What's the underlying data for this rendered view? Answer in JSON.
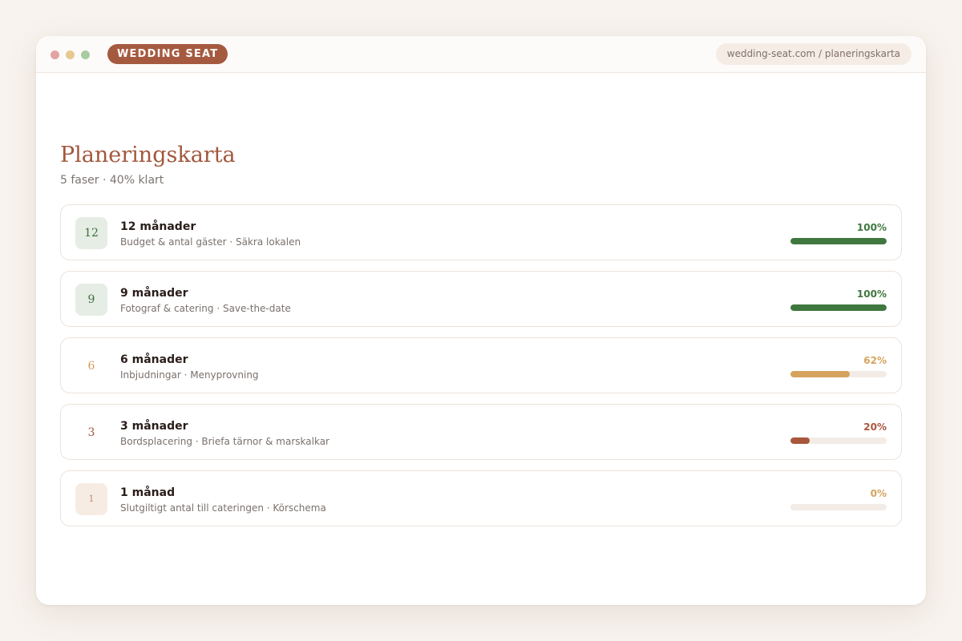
{
  "window": {
    "traffic_lights": [
      "close",
      "minimize",
      "maximize"
    ]
  },
  "brand": "WEDDING SEAT",
  "url": "wedding-seat.com / planeringskarta",
  "page": {
    "title": "Planeringskarta",
    "subtitle": "5 faser · 40% klart"
  },
  "colors": {
    "done": "#3f773e",
    "mid": "#d5a35d",
    "low": "#a8573c",
    "track": "#f3ece6",
    "accent": "#a2573c"
  },
  "phases": [
    {
      "badge": "12",
      "title": "12 månader",
      "tasks": "Budget & antal gäster · Säkra lokalen",
      "percent_label": "100%",
      "progress": 100,
      "status": "done"
    },
    {
      "badge": "9",
      "title": "9 månader",
      "tasks": "Fotograf & catering · Save-the-date",
      "percent_label": "100%",
      "progress": 100,
      "status": "done"
    },
    {
      "badge": "6",
      "title": "6 månader",
      "tasks": "Inbjudningar · Menyprovning",
      "percent_label": "62%",
      "progress": 62,
      "status": "mid"
    },
    {
      "badge": "3",
      "title": "3 månader",
      "tasks": "Bordsplacering · Briefa tärnor & marskalkar",
      "percent_label": "20%",
      "progress": 20,
      "status": "low"
    },
    {
      "badge": "1",
      "title": "1 månad",
      "tasks": "Slutgiltigt antal till cateringen · Körschema",
      "percent_label": "0%",
      "progress": 0,
      "status": "none"
    }
  ]
}
